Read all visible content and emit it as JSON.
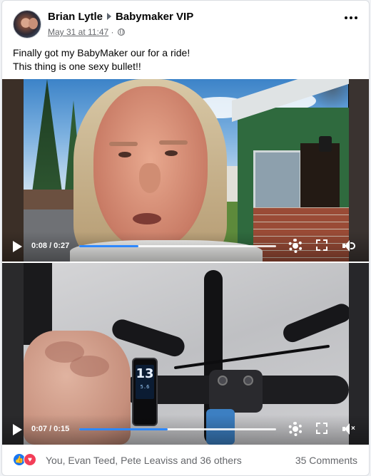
{
  "post": {
    "author": "Brian Lytle",
    "group": "Babymaker VIP",
    "date": "May 31 at 11:47",
    "separator": "·",
    "text_line1": "Finally got my BabyMaker our for a ride!",
    "text_line2": "This thing is one sexy bullet!!"
  },
  "videos": [
    {
      "time": "0:08 / 0:27",
      "progress": 0.3,
      "icons": [
        "play-icon",
        "settings-gear-icon",
        "fullscreen-icon",
        "volume-icon"
      ]
    },
    {
      "time": "0:07 / 0:15",
      "progress": 0.45,
      "display_speed": "13",
      "display_small": "5.6",
      "icons": [
        "play-icon",
        "settings-gear-icon",
        "fullscreen-icon",
        "volume-muted-icon"
      ]
    }
  ],
  "footer": {
    "reactions_text": "You, Evan Teed, Pete Leaviss and 36 others",
    "comments_text": "35 Comments",
    "reaction_icons": [
      "like-icon",
      "love-icon"
    ]
  },
  "colors": {
    "progress_fill": "#2d88ff",
    "like": "#1877f2",
    "love": "#f33e58",
    "meta_text": "#65676b"
  }
}
